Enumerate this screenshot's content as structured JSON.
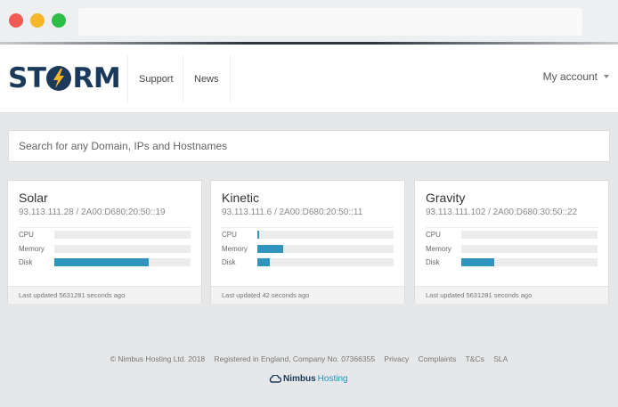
{
  "header": {
    "logo_text_left": "ST",
    "logo_text_right": "RM",
    "nav": [
      "Support",
      "News"
    ],
    "account_label": "My account"
  },
  "search": {
    "placeholder": "Search for any Domain, IPs and Hostnames"
  },
  "servers": [
    {
      "name": "Solar",
      "ips": "93.113.111.28 / 2A00:D680:20:50::19",
      "metrics": [
        {
          "label": "CPU",
          "value": 0
        },
        {
          "label": "Memory",
          "value": 0
        },
        {
          "label": "Disk",
          "value": 0.69
        }
      ],
      "updated": "Last updated 5631281 seconds ago"
    },
    {
      "name": "Kinetic",
      "ips": "93.113.111.6 / 2A00:D680:20:50::11",
      "metrics": [
        {
          "label": "CPU",
          "value": 0.015
        },
        {
          "label": "Memory",
          "value": 0.19
        },
        {
          "label": "Disk",
          "value": 0.09
        }
      ],
      "updated": "Last updated 42 seconds ago"
    },
    {
      "name": "Gravity",
      "ips": "93.113.111.102 / 2A00:D680:30:50::22",
      "metrics": [
        {
          "label": "CPU",
          "value": 0
        },
        {
          "label": "Memory",
          "value": 0
        },
        {
          "label": "Disk",
          "value": 0.24
        }
      ],
      "updated": "Last updated 5631281 seconds ago"
    }
  ],
  "footer": {
    "copyright": "© Nimbus Hosting Ltd. 2018",
    "registered": "Registered in England, Company No. 07366355",
    "links": [
      "Privacy",
      "Complaints",
      "T&Cs",
      "SLA"
    ],
    "brand_a": "Nimbus",
    "brand_b": "Hosting"
  },
  "colors": {
    "accent": "#2f94be",
    "brand": "#1b3a5b"
  }
}
